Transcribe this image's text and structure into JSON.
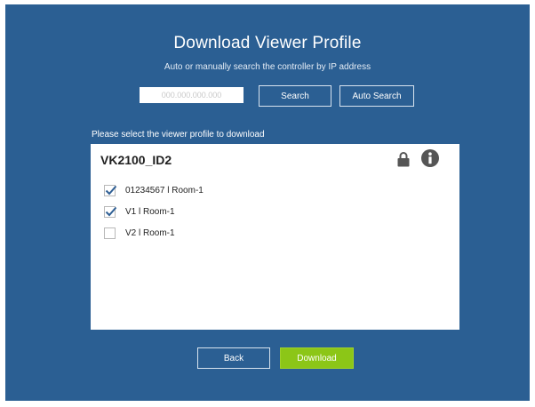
{
  "header": {
    "title": "Download Viewer Profile",
    "subtitle": "Auto or manually search the controller by IP address"
  },
  "search": {
    "ip_value": "",
    "ip_placeholder": "000.000.000.000",
    "search_label": "Search",
    "auto_search_label": "Auto Search"
  },
  "profiles": {
    "select_label": "Please select the viewer profile to download",
    "profile_name": "VK2100_ID2",
    "items": [
      {
        "label": "01234567 l Room-1",
        "checked": true
      },
      {
        "label": "V1 l Room-1",
        "checked": true
      },
      {
        "label": "V2 l Room-1",
        "checked": false
      }
    ]
  },
  "footer": {
    "back_label": "Back",
    "download_label": "Download"
  },
  "colors": {
    "background": "#2b5f93",
    "download_button": "#8cc617",
    "checkmark": "#2f5f94"
  }
}
